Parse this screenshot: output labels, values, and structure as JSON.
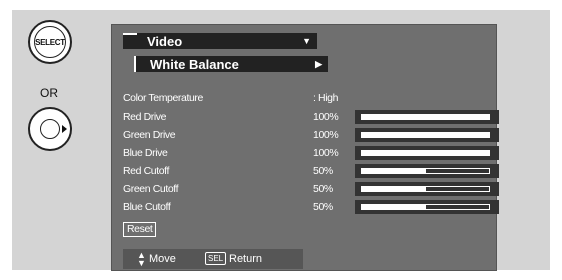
{
  "side": {
    "select_label": "SELECT",
    "or_label": "OR"
  },
  "menu": {
    "title": "Video",
    "submenu": "White Balance"
  },
  "settings": [
    {
      "label": "Color Temperature",
      "value": ": High"
    },
    {
      "label": "Red Drive",
      "value": "100%",
      "level": 1.0
    },
    {
      "label": "Green Drive",
      "value": "100%",
      "level": 1.0
    },
    {
      "label": "Blue Drive",
      "value": "100%",
      "level": 1.0
    },
    {
      "label": "Red Cutoff",
      "value": "50%",
      "level": 0.5
    },
    {
      "label": "Green Cutoff",
      "value": "50%",
      "level": 0.5
    },
    {
      "label": "Blue Cutoff",
      "value": "50%",
      "level": 0.5
    }
  ],
  "reset_label": "Reset",
  "footer": {
    "move_label": "Move",
    "sel_badge": "SEL",
    "return_label": "Return"
  }
}
